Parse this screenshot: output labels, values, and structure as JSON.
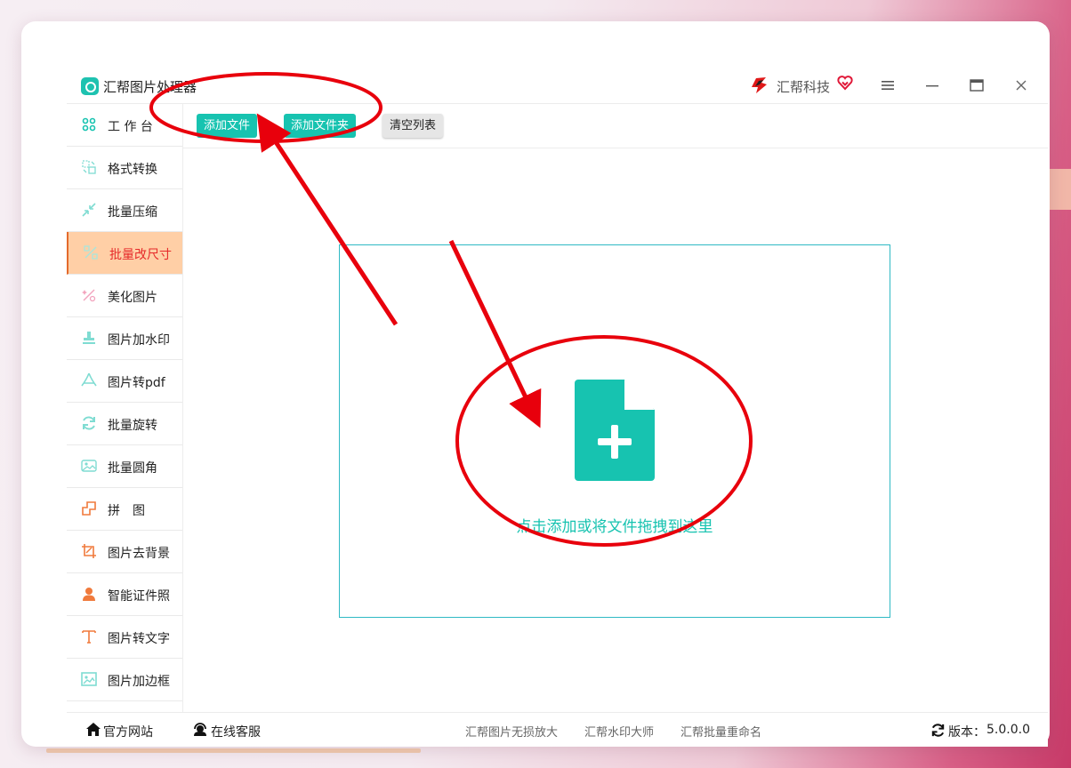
{
  "app": {
    "title": "汇帮图片处理器",
    "brand": "汇帮科技"
  },
  "window_controls": {
    "menu_icon": "hamburger-icon",
    "minimize_icon": "minimize-icon",
    "maximize_icon": "maximize-icon",
    "close_icon": "close-icon"
  },
  "sidebar": {
    "items": [
      {
        "label": "工 作 台",
        "icon": "grid-icon",
        "color": "#17c3b0"
      },
      {
        "label": "格式转换",
        "icon": "convert-icon",
        "color": "#17c3b0"
      },
      {
        "label": "批量压缩",
        "icon": "compress-icon",
        "color": "#17c3b0"
      },
      {
        "label": "批量改尺寸",
        "icon": "resize-icon",
        "color": "#17c3b0",
        "active": true
      },
      {
        "label": "美化图片",
        "icon": "beautify-icon",
        "color": "#e64a7a"
      },
      {
        "label": "图片加水印",
        "icon": "stamp-icon",
        "color": "#17c3b0"
      },
      {
        "label": "图片转pdf",
        "icon": "pdf-icon",
        "color": "#17c3b0"
      },
      {
        "label": "批量旋转",
        "icon": "rotate-icon",
        "color": "#17c3b0"
      },
      {
        "label": "批量圆角",
        "icon": "rounded-image-icon",
        "color": "#17c3b0"
      },
      {
        "label": "拼　图",
        "icon": "puzzle-icon",
        "color": "#f07a3c"
      },
      {
        "label": "图片去背景",
        "icon": "crop-icon",
        "color": "#f07a3c"
      },
      {
        "label": "智能证件照",
        "icon": "person-icon",
        "color": "#f07a3c"
      },
      {
        "label": "图片转文字",
        "icon": "text-icon",
        "color": "#f07a3c"
      },
      {
        "label": "图片加边框",
        "icon": "frame-icon",
        "color": "#17c3b0"
      }
    ]
  },
  "toolbar": {
    "add_file": "添加文件",
    "add_folder": "添加文件夹",
    "clear_list": "清空列表"
  },
  "dropzone": {
    "text": "点击添加或将文件拖拽到这里",
    "icon": "add-file-icon"
  },
  "footer": {
    "official_site": "官方网站",
    "online_support": "在线客服",
    "links": [
      "汇帮图片无损放大",
      "汇帮水印大师",
      "汇帮批量重命名"
    ],
    "version_label": "版本：",
    "version": "5.0.0.0"
  },
  "colors": {
    "accent": "#17c3b0",
    "active_bg": "#ffcfa6",
    "active_text": "#e62a2a",
    "annotation": "#e8000c"
  }
}
